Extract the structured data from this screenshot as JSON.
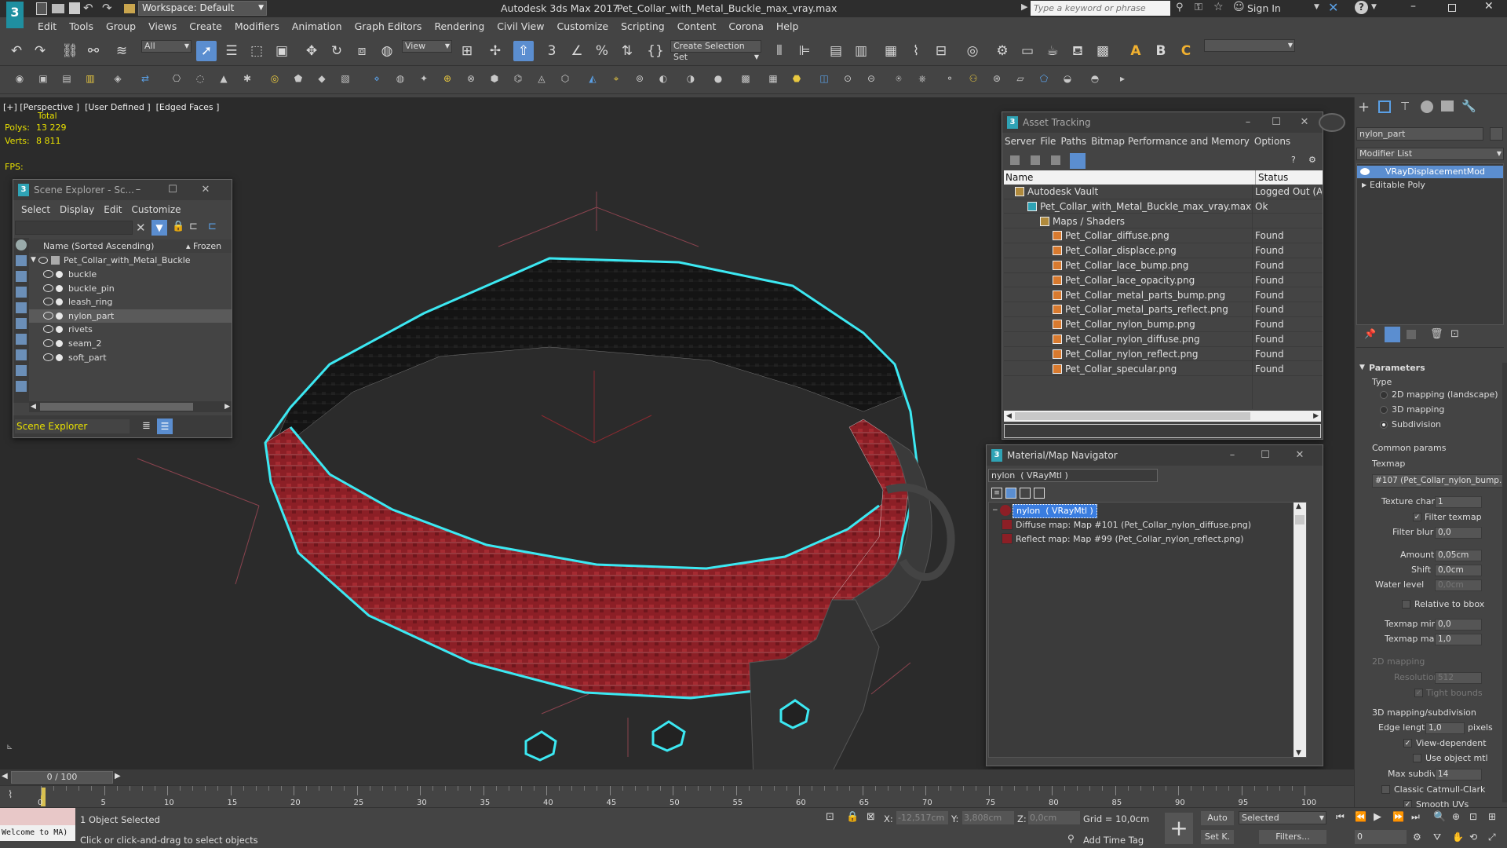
{
  "title": {
    "workspace": "Workspace: Default",
    "app": "Autodesk 3ds Max 2017",
    "file": "Pet_Collar_with_Metal_Buckle_max_vray.max",
    "search_placeholder": "Type a keyword or phrase",
    "sign_in": "Sign In"
  },
  "menu": [
    "Edit",
    "Tools",
    "Group",
    "Views",
    "Create",
    "Modifiers",
    "Animation",
    "Graph Editors",
    "Rendering",
    "Civil View",
    "Customize",
    "Scripting",
    "Content",
    "Corona",
    "Help"
  ],
  "toolbar": {
    "filter_select": "All",
    "view_select": "View",
    "selection_set": "Create Selection Set"
  },
  "viewport": {
    "labels": "[+] [Perspective ]  [User Defined ]  [Edged Faces ]",
    "total": "Total",
    "polys_label": "Polys:",
    "polys_value": "13 229",
    "verts_label": "Verts:",
    "verts_value": "8 811",
    "fps_label": "FPS:"
  },
  "scene_explorer": {
    "title": "Scene Explorer - Sc...",
    "menu": [
      "Select",
      "Display",
      "Edit",
      "Customize"
    ],
    "col_name": "Name (Sorted Ascending)",
    "col_frozen": "▴ Frozen",
    "root": "Pet_Collar_with_Metal_Buckle",
    "items": [
      "buckle",
      "buckle_pin",
      "leash_ring",
      "nylon_part",
      "rivets",
      "seam_2",
      "soft_part"
    ],
    "footer": "Scene Explorer"
  },
  "asset_tracking": {
    "title": "Asset Tracking",
    "menu": [
      "Server",
      "File",
      "Paths",
      "Bitmap Performance and Memory",
      "Options"
    ],
    "col_name": "Name",
    "col_status": "Status",
    "rows": [
      {
        "name": "Autodesk Vault",
        "status": "Logged Out (As",
        "indent": 1
      },
      {
        "name": "Pet_Collar_with_Metal_Buckle_max_vray.max",
        "status": "Ok",
        "indent": 2
      },
      {
        "name": "Maps / Shaders",
        "status": "",
        "indent": 3
      },
      {
        "name": "Pet_Collar_diffuse.png",
        "status": "Found",
        "indent": 4
      },
      {
        "name": "Pet_Collar_displace.png",
        "status": "Found",
        "indent": 4
      },
      {
        "name": "Pet_Collar_lace_bump.png",
        "status": "Found",
        "indent": 4
      },
      {
        "name": "Pet_Collar_lace_opacity.png",
        "status": "Found",
        "indent": 4
      },
      {
        "name": "Pet_Collar_metal_parts_bump.png",
        "status": "Found",
        "indent": 4
      },
      {
        "name": "Pet_Collar_metal_parts_reflect.png",
        "status": "Found",
        "indent": 4
      },
      {
        "name": "Pet_Collar_nylon_bump.png",
        "status": "Found",
        "indent": 4
      },
      {
        "name": "Pet_Collar_nylon_diffuse.png",
        "status": "Found",
        "indent": 4
      },
      {
        "name": "Pet_Collar_nylon_reflect.png",
        "status": "Found",
        "indent": 4
      },
      {
        "name": "Pet_Collar_specular.png",
        "status": "Found",
        "indent": 4
      }
    ]
  },
  "material_navigator": {
    "title": "Material/Map Navigator",
    "field": "nylon  ( VRayMtl )",
    "root": "nylon  ( VRayMtl )",
    "children": [
      "Diffuse map: Map #101 (Pet_Collar_nylon_diffuse.png)",
      "Reflect map: Map #99 (Pet_Collar_nylon_reflect.png)"
    ]
  },
  "command_panel": {
    "object_name": "nylon_part",
    "modifier_list": "Modifier List",
    "stack": [
      "VRayDisplacementMod",
      "Editable Poly"
    ],
    "parameters": "Parameters",
    "type_label": "Type",
    "types": [
      "2D mapping (landscape)",
      "3D mapping",
      "Subdivision"
    ],
    "common_params": "Common params",
    "texmap_label": "Texmap",
    "texmap_value": "#107 (Pet_Collar_nylon_bump.",
    "texture_chan_label": "Texture chan",
    "texture_chan_value": "1",
    "filter_texmap": "Filter texmap",
    "filter_blur_label": "Filter blur",
    "filter_blur_value": "0,0",
    "amount_label": "Amount",
    "amount_value": "0,05cm",
    "shift_label": "Shift",
    "shift_value": "0,0cm",
    "water_level_label": "Water level",
    "water_level_value": "0,0cm",
    "relative_bbox": "Relative to bbox",
    "texmap_min_label": "Texmap min",
    "texmap_min_value": "0,0",
    "texmap_max_label": "Texmap max",
    "texmap_max_value": "1,0",
    "mapping2d": "2D mapping",
    "resolution_label": "Resolution",
    "resolution_value": "512",
    "tight_bounds": "Tight bounds",
    "mapping3d": "3D mapping/subdivision",
    "edge_length_label": "Edge length",
    "edge_length_value": "1,0",
    "pixels": "pixels",
    "view_dependent": "View-dependent",
    "use_object_mtl": "Use object mtl",
    "max_subdivs_label": "Max subdivs",
    "max_subdivs_value": "14",
    "classic_catmull": "Classic Catmull-Clark",
    "smooth_uvs": "Smooth UVs"
  },
  "timeline": {
    "frame": "0 / 100",
    "ticks": [
      "0",
      "5",
      "10",
      "15",
      "20",
      "25",
      "30",
      "35",
      "40",
      "45",
      "50",
      "55",
      "60",
      "65",
      "70",
      "75",
      "80",
      "85",
      "90",
      "95",
      "100"
    ]
  },
  "status": {
    "maxscript": "Welcome to MA)",
    "selected": "1 Object Selected",
    "prompt": "Click or click-and-drag to select objects",
    "x_label": "X:",
    "x_value": "-12,517cm",
    "y_label": "Y:",
    "y_value": "3,808cm",
    "z_label": "Z:",
    "z_value": "0,0cm",
    "grid": "Grid = 10,0cm",
    "add_time_tag": "Add Time Tag",
    "auto": "Auto",
    "selected_dd": "Selected",
    "set_k": "Set K.",
    "filters": "Filters...",
    "frame_field": "0"
  }
}
